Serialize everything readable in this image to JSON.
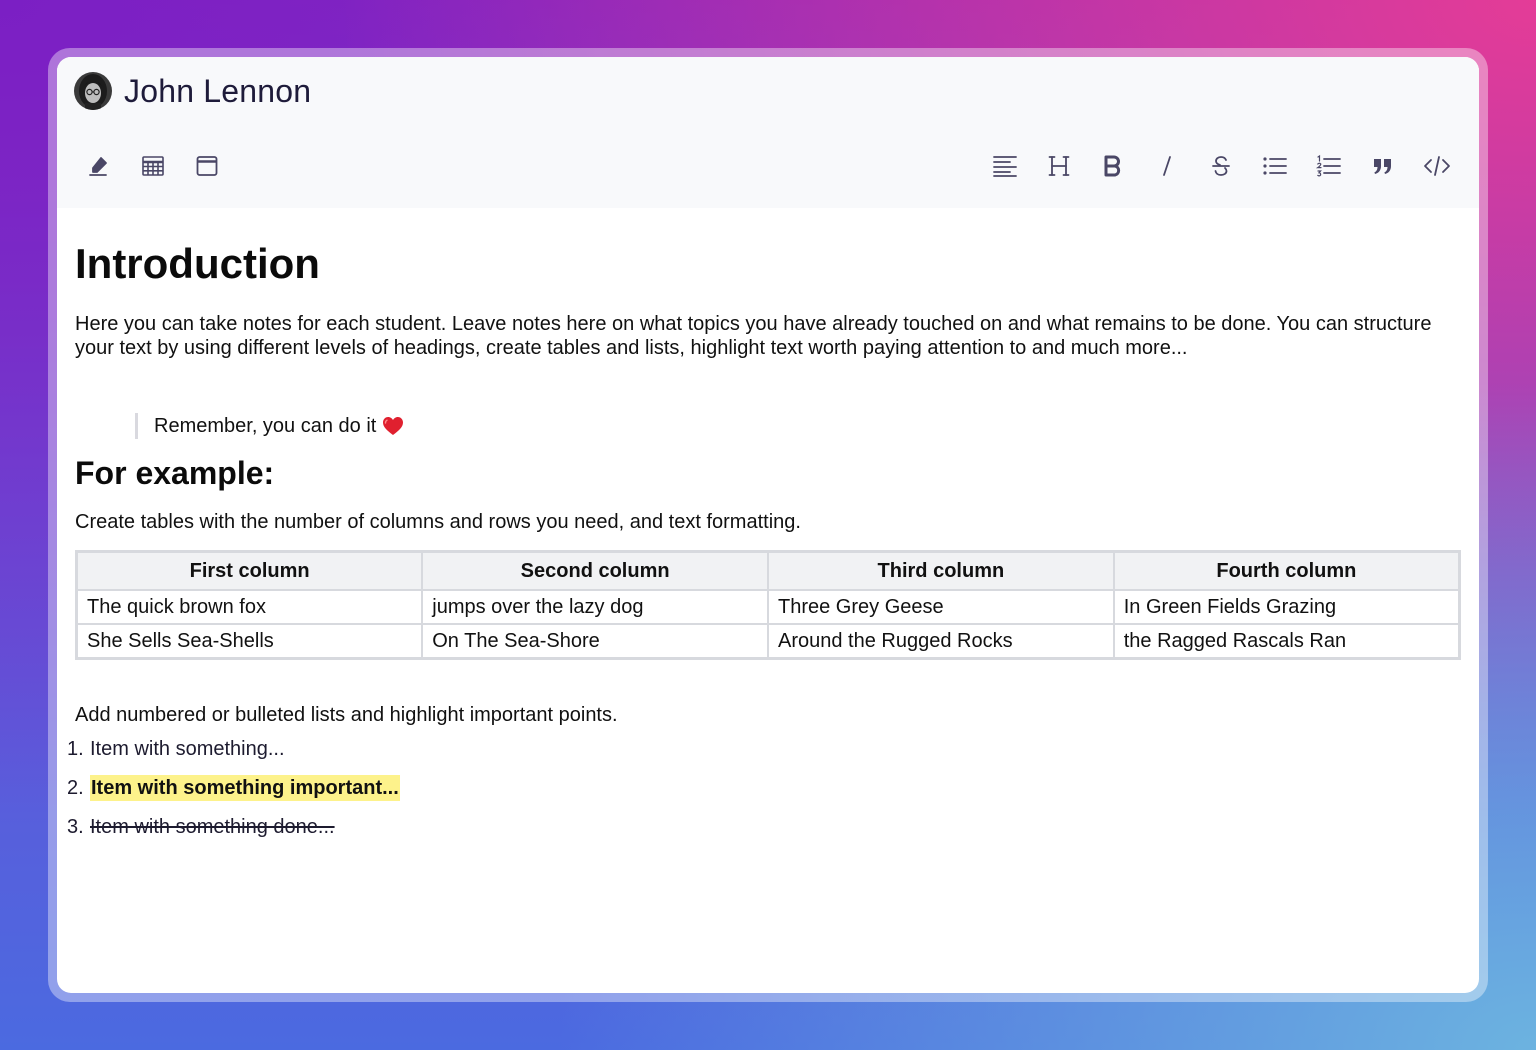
{
  "header": {
    "user_name": "John Lennon"
  },
  "toolbar": {
    "left_tools": [
      {
        "icon": "highlighter-icon"
      },
      {
        "icon": "table-icon"
      },
      {
        "icon": "window-icon"
      }
    ],
    "right_tools": [
      {
        "icon": "paragraph-icon"
      },
      {
        "icon": "heading-icon"
      },
      {
        "icon": "bold-icon"
      },
      {
        "icon": "italic-icon"
      },
      {
        "icon": "strikethrough-icon"
      },
      {
        "icon": "bullet-list-icon"
      },
      {
        "icon": "numbered-list-icon"
      },
      {
        "icon": "blockquote-icon"
      },
      {
        "icon": "code-icon"
      }
    ]
  },
  "doc": {
    "title": "Introduction",
    "intro": "Here you can take notes for each student. Leave notes here on what topics you have already touched on and what remains to be done. You can structure your text by using different levels of headings, create tables and lists, highlight text worth paying attention to and much more...",
    "quote": "Remember, you can do it",
    "subtitle": "For example:",
    "table_intro": "Create tables with the number of columns and rows you need, and text formatting.",
    "table": {
      "headers": [
        "First column",
        "Second column",
        "Third column",
        "Fourth column"
      ],
      "rows": [
        [
          "The quick brown fox",
          "jumps over the lazy dog",
          "Three Grey Geese",
          "In Green Fields Grazing"
        ],
        [
          "She Sells Sea-Shells",
          "On The Sea-Shore",
          "Around the Rugged Rocks",
          "the Ragged Rascals Ran"
        ]
      ]
    },
    "list_intro": "Add numbered or bulleted lists and highlight important points.",
    "list": [
      {
        "num": "1.",
        "text": "Item with something..."
      },
      {
        "num": "2.",
        "text": "Item with something important..."
      },
      {
        "num": "3.",
        "text": "Item with something done..."
      }
    ]
  },
  "colors": {
    "highlight": "#fdf28b",
    "header_bg": "#f8f9fb",
    "icon": "#4a4766"
  }
}
